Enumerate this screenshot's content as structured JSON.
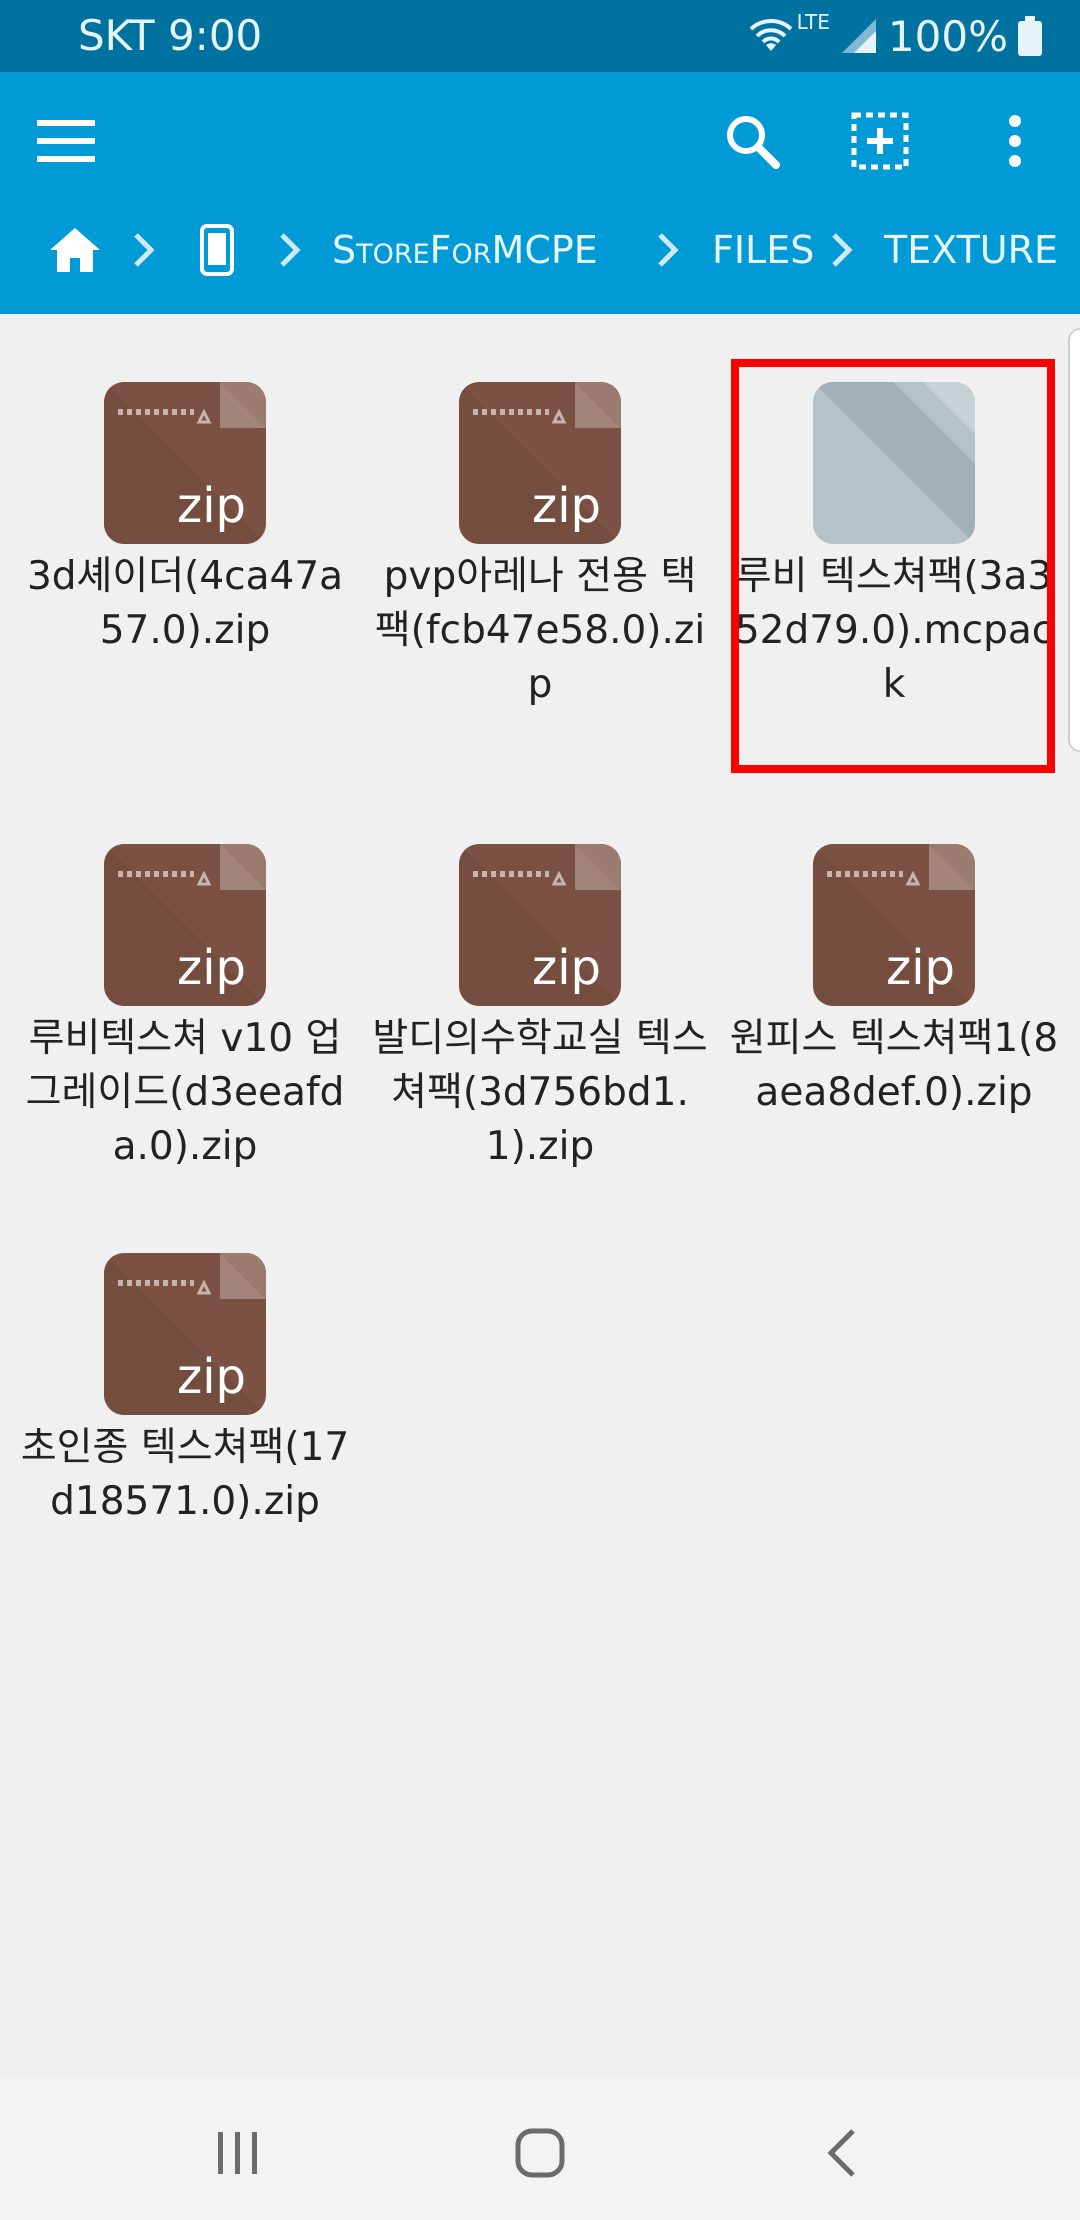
{
  "status": {
    "carrier_time": "SKT 9:00",
    "network": "LTE",
    "battery": "100%"
  },
  "toolbar": {
    "icons": [
      "menu-icon",
      "search-icon",
      "add-select-icon",
      "more-vert-icon"
    ]
  },
  "breadcrumb": {
    "items": [
      {
        "type": "icon",
        "name": "home-icon"
      },
      {
        "type": "icon",
        "name": "phone-icon"
      },
      {
        "type": "text",
        "label": "StoreForMCPE"
      },
      {
        "type": "text",
        "label": "FILES"
      },
      {
        "type": "text",
        "label": "TEXTURE"
      }
    ]
  },
  "files": [
    {
      "name": "3d셰이더(4ca47a57.0).zip",
      "kind": "zip",
      "thumb_label": "zip"
    },
    {
      "name": "pvp아레나 전용 택팩(fcb47e58.0).zip",
      "kind": "zip",
      "thumb_label": "zip"
    },
    {
      "name": "루비 텍스쳐팩(3a352d79.0).mcpack",
      "kind": "mcpack",
      "selected": true
    },
    {
      "name": "루비텍스쳐 v10 업그레이드(d3eeafda.0).zip",
      "kind": "zip",
      "thumb_label": "zip"
    },
    {
      "name": "발디의수학교실 텍스쳐팩(3d756bd1.1).zip",
      "kind": "zip",
      "thumb_label": "zip"
    },
    {
      "name": "원피스 텍스쳐팩1(8aea8def.0).zip",
      "kind": "zip",
      "thumb_label": "zip"
    },
    {
      "name": "초인종 텍스쳐팩(17d18571.0).zip",
      "kind": "zip",
      "thumb_label": "zip"
    }
  ],
  "nav": {
    "icons": [
      "recent-apps-icon",
      "home-button-icon",
      "back-icon"
    ]
  },
  "colors": {
    "status_bar": "#00729f",
    "app_bar": "#009bd6",
    "zip_thumb": "#7a5142",
    "selection": "#ff0000"
  }
}
